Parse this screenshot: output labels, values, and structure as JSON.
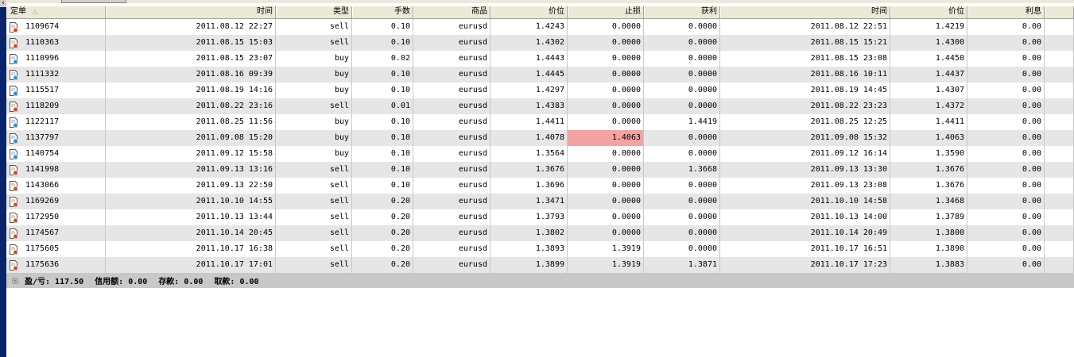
{
  "columns": [
    "定单",
    "时间",
    "类型",
    "手数",
    "商品",
    "价位",
    "止损",
    "获利",
    "时间",
    "价位",
    "利息",
    ""
  ],
  "sort_indicator": "△",
  "rows": [
    {
      "ticket": "1109674",
      "open_time": "2011.08.12 22:27",
      "type": "sell",
      "lots": "0.10",
      "symbol": "eurusd",
      "open_price": "1.4243",
      "sl": "0.0000",
      "tp": "0.0000",
      "close_time": "2011.08.12 22:51",
      "close_price": "1.4219",
      "swap": "0.00",
      "dir": "sell"
    },
    {
      "ticket": "1110363",
      "open_time": "2011.08.15 15:03",
      "type": "sell",
      "lots": "0.10",
      "symbol": "eurusd",
      "open_price": "1.4302",
      "sl": "0.0000",
      "tp": "0.0000",
      "close_time": "2011.08.15 15:21",
      "close_price": "1.4300",
      "swap": "0.00",
      "dir": "sell"
    },
    {
      "ticket": "1110996",
      "open_time": "2011.08.15 23:07",
      "type": "buy",
      "lots": "0.02",
      "symbol": "eurusd",
      "open_price": "1.4443",
      "sl": "0.0000",
      "tp": "0.0000",
      "close_time": "2011.08.15 23:08",
      "close_price": "1.4450",
      "swap": "0.00",
      "dir": "buy"
    },
    {
      "ticket": "1111332",
      "open_time": "2011.08.16 09:39",
      "type": "buy",
      "lots": "0.10",
      "symbol": "eurusd",
      "open_price": "1.4445",
      "sl": "0.0000",
      "tp": "0.0000",
      "close_time": "2011.08.16 10:11",
      "close_price": "1.4437",
      "swap": "0.00",
      "dir": "buy"
    },
    {
      "ticket": "1115517",
      "open_time": "2011.08.19 14:16",
      "type": "buy",
      "lots": "0.10",
      "symbol": "eurusd",
      "open_price": "1.4297",
      "sl": "0.0000",
      "tp": "0.0000",
      "close_time": "2011.08.19 14:45",
      "close_price": "1.4307",
      "swap": "0.00",
      "dir": "buy"
    },
    {
      "ticket": "1118209",
      "open_time": "2011.08.22 23:16",
      "type": "sell",
      "lots": "0.01",
      "symbol": "eurusd",
      "open_price": "1.4383",
      "sl": "0.0000",
      "tp": "0.0000",
      "close_time": "2011.08.22 23:23",
      "close_price": "1.4372",
      "swap": "0.00",
      "dir": "sell"
    },
    {
      "ticket": "1122117",
      "open_time": "2011.08.25 11:56",
      "type": "buy",
      "lots": "0.10",
      "symbol": "eurusd",
      "open_price": "1.4411",
      "sl": "0.0000",
      "tp": "1.4419",
      "close_time": "2011.08.25 12:25",
      "close_price": "1.4411",
      "swap": "0.00",
      "dir": "buy"
    },
    {
      "ticket": "1137797",
      "open_time": "2011.09.08 15:20",
      "type": "buy",
      "lots": "0.10",
      "symbol": "eurusd",
      "open_price": "1.4078",
      "sl": "1.4063",
      "tp": "0.0000",
      "close_time": "2011.09.08 15:32",
      "close_price": "1.4063",
      "swap": "0.00",
      "dir": "buy",
      "sl_highlight": true
    },
    {
      "ticket": "1140754",
      "open_time": "2011.09.12 15:58",
      "type": "buy",
      "lots": "0.10",
      "symbol": "eurusd",
      "open_price": "1.3564",
      "sl": "0.0000",
      "tp": "0.0000",
      "close_time": "2011.09.12 16:14",
      "close_price": "1.3590",
      "swap": "0.00",
      "dir": "buy"
    },
    {
      "ticket": "1141998",
      "open_time": "2011.09.13 13:16",
      "type": "sell",
      "lots": "0.10",
      "symbol": "eurusd",
      "open_price": "1.3676",
      "sl": "0.0000",
      "tp": "1.3668",
      "close_time": "2011.09.13 13:30",
      "close_price": "1.3676",
      "swap": "0.00",
      "dir": "sell"
    },
    {
      "ticket": "1143066",
      "open_time": "2011.09.13 22:50",
      "type": "sell",
      "lots": "0.10",
      "symbol": "eurusd",
      "open_price": "1.3696",
      "sl": "0.0000",
      "tp": "0.0000",
      "close_time": "2011.09.13 23:08",
      "close_price": "1.3676",
      "swap": "0.00",
      "dir": "sell"
    },
    {
      "ticket": "1169269",
      "open_time": "2011.10.10 14:55",
      "type": "sell",
      "lots": "0.20",
      "symbol": "eurusd",
      "open_price": "1.3471",
      "sl": "0.0000",
      "tp": "0.0000",
      "close_time": "2011.10.10 14:58",
      "close_price": "1.3468",
      "swap": "0.00",
      "dir": "sell"
    },
    {
      "ticket": "1172950",
      "open_time": "2011.10.13 13:44",
      "type": "sell",
      "lots": "0.20",
      "symbol": "eurusd",
      "open_price": "1.3793",
      "sl": "0.0000",
      "tp": "0.0000",
      "close_time": "2011.10.13 14:00",
      "close_price": "1.3789",
      "swap": "0.00",
      "dir": "sell"
    },
    {
      "ticket": "1174567",
      "open_time": "2011.10.14 20:45",
      "type": "sell",
      "lots": "0.20",
      "symbol": "eurusd",
      "open_price": "1.3802",
      "sl": "0.0000",
      "tp": "0.0000",
      "close_time": "2011.10.14 20:49",
      "close_price": "1.3800",
      "swap": "0.00",
      "dir": "sell"
    },
    {
      "ticket": "1175605",
      "open_time": "2011.10.17 16:38",
      "type": "sell",
      "lots": "0.20",
      "symbol": "eurusd",
      "open_price": "1.3893",
      "sl": "1.3919",
      "tp": "0.0000",
      "close_time": "2011.10.17 16:51",
      "close_price": "1.3890",
      "swap": "0.00",
      "dir": "sell"
    },
    {
      "ticket": "1175636",
      "open_time": "2011.10.17 17:01",
      "type": "sell",
      "lots": "0.20",
      "symbol": "eurusd",
      "open_price": "1.3899",
      "sl": "1.3919",
      "tp": "1.3871",
      "close_time": "2011.10.17 17:23",
      "close_price": "1.3883",
      "swap": "0.00",
      "dir": "sell"
    }
  ],
  "summary": {
    "pl": "盈/亏: 117.50",
    "credit": "信用额: 0.00",
    "deposit": "存款: 0.00",
    "withdrawal": "取款: 0.00"
  },
  "colors": {
    "sell_icon": "#d94a1a",
    "buy_icon": "#2a8fd0",
    "highlight": "#f4a3a3",
    "side_bar": "#0a246a"
  },
  "icons": {
    "sell": "sell-order-icon",
    "buy": "buy-order-icon",
    "summary": "summary-dot-icon"
  }
}
